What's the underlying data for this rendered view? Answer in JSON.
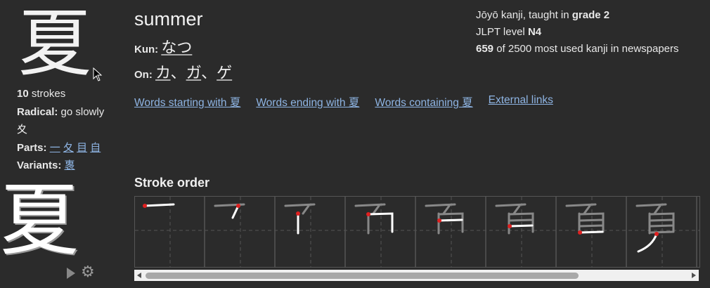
{
  "kanji": {
    "character": "夏",
    "strokes_count": "10",
    "strokes_label": " strokes",
    "radical_label": "Radical:",
    "radical_meaning": " go slowly",
    "radical_char": "夊",
    "parts_label": "Parts:",
    "parts": [
      "一",
      "夂",
      "目",
      "自"
    ],
    "variants_label": "Variants:",
    "variants": [
      "褢"
    ]
  },
  "meaning": "summer",
  "readings": {
    "kun_label": "Kun:",
    "kun": [
      "なつ"
    ],
    "on_label": "On:",
    "on": [
      "カ",
      "ガ",
      "ゲ"
    ],
    "separator": "、"
  },
  "stats": {
    "joyo_prefix": "Jōyō kanji, taught in ",
    "grade": "grade 2",
    "jlpt_prefix": "JLPT level ",
    "jlpt": "N4",
    "rank": "659",
    "rank_suffix": " of 2500 most used kanji in newspapers"
  },
  "links": [
    "Words starting with 夏",
    "Words ending with 夏",
    "Words containing 夏",
    "External links"
  ],
  "stroke_order": {
    "title": "Stroke order",
    "frames_visible": 8
  },
  "icons": {
    "play": "play-icon",
    "settings": "gear-icon",
    "cursor": "mouse-cursor-icon"
  },
  "colors": {
    "background": "#2b2b2b",
    "link": "#8eb4e3",
    "stroke_start": "#e02020"
  }
}
